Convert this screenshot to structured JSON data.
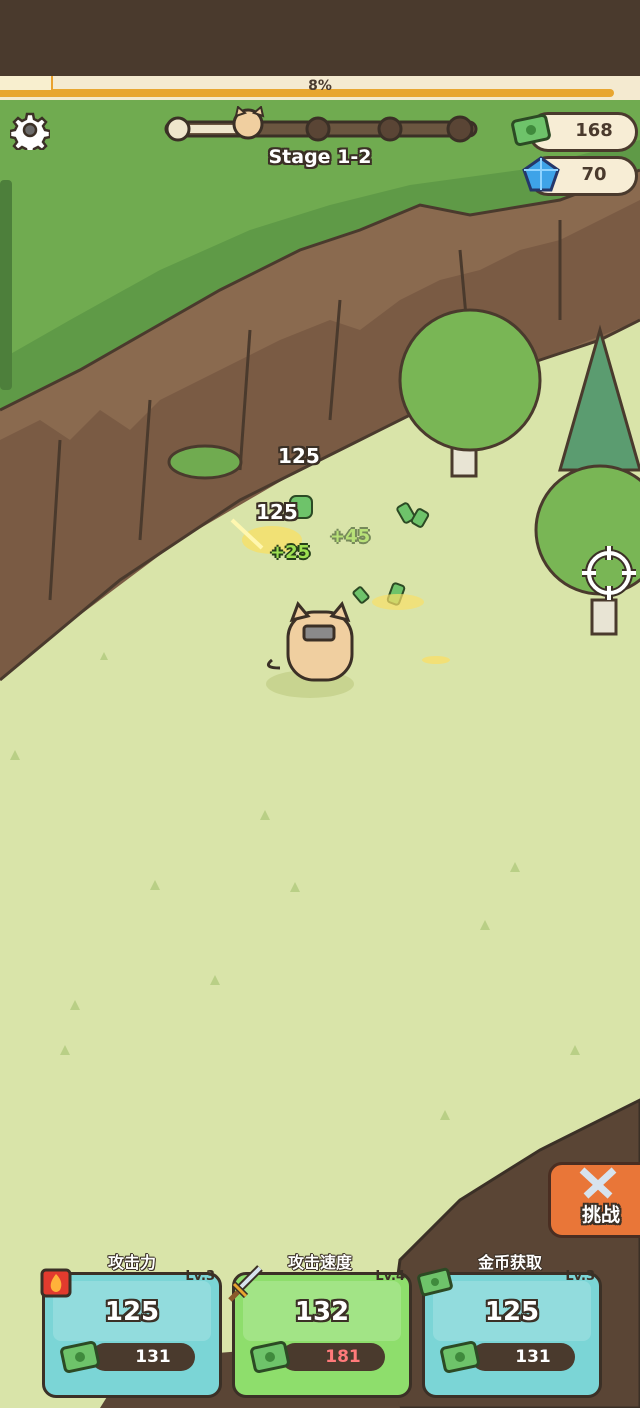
{
  "progress": {
    "label": "8%",
    "value": 0.08
  },
  "stage": {
    "label": "Stage 1-2",
    "nodes_total": 5,
    "current_node": 2
  },
  "currency": {
    "cash": "168",
    "gems": "70"
  },
  "combat": {
    "damage_numbers": [
      "125",
      "125"
    ],
    "coin_gains": [
      "+25",
      "+45"
    ]
  },
  "challenge": {
    "label": "挑战"
  },
  "upgrades": [
    {
      "title": "攻击力",
      "level": "Lv.3",
      "value": "125",
      "cost": "131",
      "affordable": true,
      "icon": "fire-icon"
    },
    {
      "title": "攻击速度",
      "level": "Lv.4",
      "value": "132",
      "cost": "181",
      "affordable": false,
      "icon": "sword-icon"
    },
    {
      "title": "金币获取",
      "level": "Lv.3",
      "value": "125",
      "cost": "131",
      "affordable": true,
      "icon": "cash-icon"
    }
  ],
  "colors": {
    "accent": "#e9a12e",
    "card_blue": "#7bd5d6",
    "card_green": "#8ede6c",
    "outline": "#3b3026",
    "cost_warn": "#ff7a7a"
  }
}
